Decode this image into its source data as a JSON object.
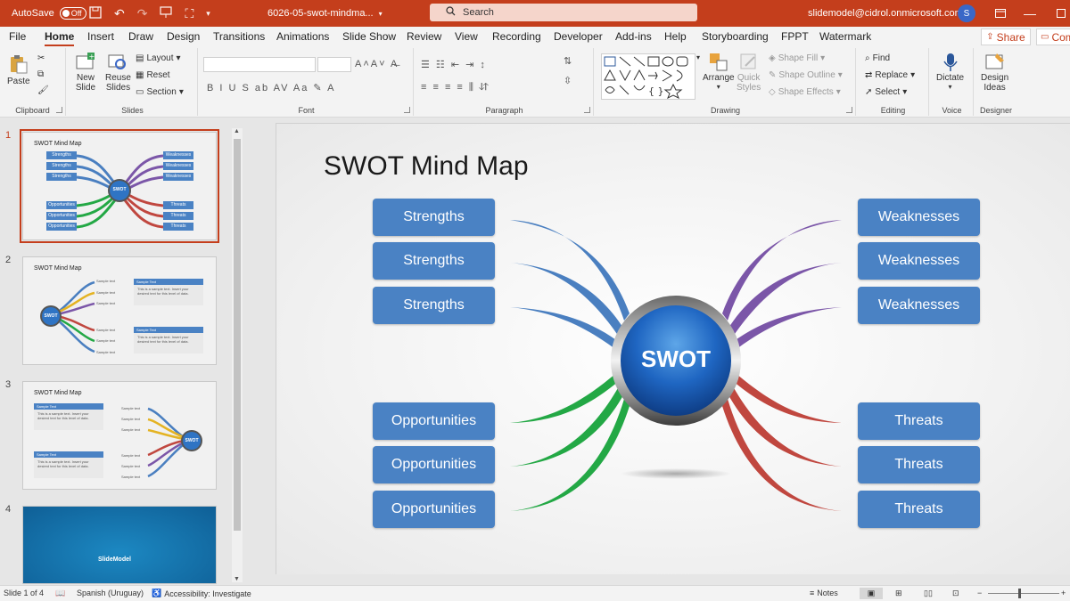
{
  "titlebar": {
    "autosave_label": "AutoSave",
    "autosave_state": "Off",
    "filename": "6026-05-swot-mindma...",
    "search_placeholder": "Search",
    "account": "slidemodel@cidrol.onmicrosoft.com",
    "avatar_initial": "S"
  },
  "menu": {
    "tabs": [
      "File",
      "Home",
      "Insert",
      "Draw",
      "Design",
      "Transitions",
      "Animations",
      "Slide Show",
      "Review",
      "View",
      "Recording",
      "Developer",
      "Add-ins",
      "Help",
      "Storyboarding",
      "FPPT",
      "Watermark"
    ],
    "active": "Home",
    "share": "Share",
    "comments": "Com"
  },
  "ribbon": {
    "clipboard": {
      "label": "Clipboard",
      "paste": "Paste"
    },
    "slides": {
      "label": "Slides",
      "new_slide_1": "New",
      "new_slide_2": "Slide",
      "reuse_1": "Reuse",
      "reuse_2": "Slides",
      "layout": "Layout",
      "reset": "Reset",
      "section": "Section"
    },
    "font": {
      "label": "Font"
    },
    "paragraph": {
      "label": "Paragraph"
    },
    "drawing": {
      "label": "Drawing",
      "arrange": "Arrange",
      "quick_styles_1": "Quick",
      "quick_styles_2": "Styles",
      "shape_fill": "Shape Fill",
      "shape_outline": "Shape Outline",
      "shape_effects": "Shape Effects"
    },
    "editing": {
      "label": "Editing",
      "find": "Find",
      "replace": "Replace",
      "select": "Select"
    },
    "voice": {
      "label": "Voice",
      "dictate": "Dictate"
    },
    "designer": {
      "label": "Designer",
      "design_ideas_1": "Design",
      "design_ideas_2": "Ideas"
    }
  },
  "thumbnails": {
    "slides": [
      {
        "num": "1",
        "title": "SWOT Mind Map"
      },
      {
        "num": "2",
        "title": "SWOT Mind Map"
      },
      {
        "num": "3",
        "title": "SWOT Mind Map"
      },
      {
        "num": "4",
        "title": ""
      }
    ],
    "thumb1": {
      "strengths": [
        "Strengths",
        "Strengths",
        "Strengths"
      ],
      "weaknesses": [
        "Weaknesses",
        "Weaknesses",
        "Weaknesses"
      ],
      "opportunities": [
        "Opportunities",
        "Opportunities",
        "Opportunities"
      ],
      "threats": [
        "Threats",
        "Threats",
        "Threats"
      ],
      "center": "SWOT"
    },
    "thumb2": {
      "center": "SWOT",
      "sample_texts": [
        "Sample text",
        "Sample text",
        "Sample text",
        "Sample text",
        "Sample text",
        "Sample text",
        "Sample text"
      ],
      "card_title": "Sample Text",
      "card_body": "This is a sample text. Insert your desired text for this level of data."
    },
    "thumb3": {
      "center": "SWOT",
      "card_title": "Sample Text",
      "card_body": "This is a sample text. Insert your desired text for this level of data.",
      "sample_texts": [
        "Sample text",
        "Sample text",
        "Sample text",
        "Sample text",
        "Sample text",
        "Sample text"
      ]
    },
    "thumb4": {
      "brand": "SlideModel"
    }
  },
  "slide": {
    "title": "SWOT Mind Map",
    "center": "SWOT",
    "strengths": [
      "Strengths",
      "Strengths",
      "Strengths"
    ],
    "weaknesses": [
      "Weaknesses",
      "Weaknesses",
      "Weaknesses"
    ],
    "opportunities": [
      "Opportunities",
      "Opportunities",
      "Opportunities"
    ],
    "threats": [
      "Threats",
      "Threats",
      "Threats"
    ],
    "colors": {
      "box": "#4a82c4",
      "strengths_branch": "#4a7fc0",
      "weaknesses_branch": "#7b56a8",
      "opportunities_branch": "#23a845",
      "threats_branch": "#c0473f"
    }
  },
  "statusbar": {
    "slide_counter": "Slide 1 of 4",
    "language": "Spanish (Uruguay)",
    "accessibility": "Accessibility: Investigate",
    "notes": "Notes"
  }
}
